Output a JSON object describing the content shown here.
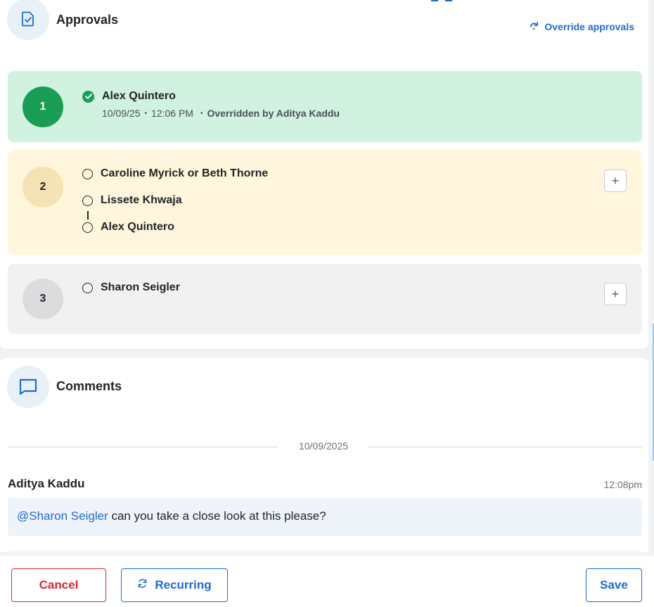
{
  "approvals": {
    "title": "Approvals",
    "override_label": "Override approvals",
    "steps": [
      {
        "number": "1",
        "status": "approved",
        "approvers": [
          "Alex Quintero"
        ],
        "date": "10/09/25",
        "time": "12:06 PM",
        "note": "Overridden by Aditya Kaddu"
      },
      {
        "number": "2",
        "status": "pending",
        "approvers": [
          "Caroline Myrick or Beth Thorne",
          "Lissete Khwaja",
          "Alex Quintero"
        ]
      },
      {
        "number": "3",
        "status": "pending",
        "approvers": [
          "Sharon Seigler"
        ]
      }
    ],
    "add_label": "+"
  },
  "comments": {
    "title": "Comments",
    "date_divider": "10/09/2025",
    "items": [
      {
        "author": "Aditya Kaddu",
        "time": "12:08pm",
        "mention": "@Sharon Seigler",
        "text": " can you take a close look at this please?"
      }
    ]
  },
  "footer": {
    "cancel_label": "Cancel",
    "recurring_label": "Recurring",
    "save_label": "Save"
  },
  "colors": {
    "accent": "#1b6bd6",
    "approved_green": "#1a9d55",
    "approved_bg": "#d1f2e0",
    "pending_bg": "#fff6dd",
    "future_bg": "#f1f1f2",
    "danger": "#e0262c"
  },
  "icons": {
    "approvals": "document-check-icon",
    "override": "redo-arrow-icon",
    "approved": "check-circle-icon",
    "comments": "chat-bubble-icon",
    "recurring": "refresh-icon",
    "add": "plus-icon"
  }
}
